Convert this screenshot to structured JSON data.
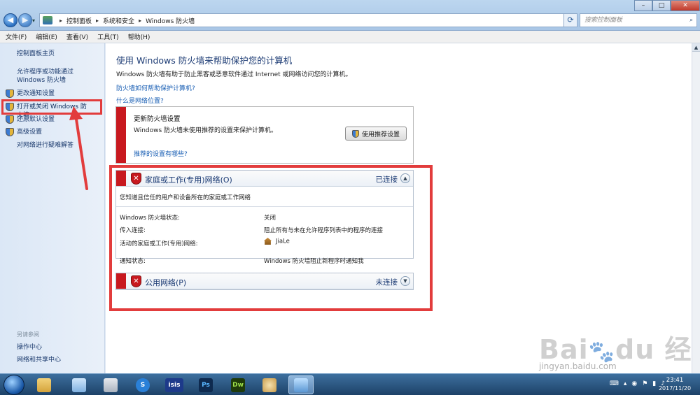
{
  "window": {
    "breadcrumbs": [
      "控制面板",
      "系统和安全",
      "Windows 防火墙"
    ],
    "search_placeholder": "搜索控制面板"
  },
  "menu": [
    "文件(F)",
    "编辑(E)",
    "查看(V)",
    "工具(T)",
    "帮助(H)"
  ],
  "sidebar": {
    "home": "控制面板主页",
    "items": [
      {
        "label": "允许程序或功能通过 Windows 防火墙",
        "icon": "none"
      },
      {
        "label": "更改通知设置",
        "icon": "shield-icon"
      },
      {
        "label": "打开或关闭 Windows 防火墙",
        "icon": "shield-icon"
      },
      {
        "label": "还原默认设置",
        "icon": "shield-icon"
      },
      {
        "label": "高级设置",
        "icon": "shield-icon"
      },
      {
        "label": "对网络进行疑难解答",
        "icon": "none"
      }
    ],
    "see_also_title": "另请参阅",
    "see_also": [
      "操作中心",
      "网络和共享中心"
    ]
  },
  "main": {
    "title": "使用 Windows 防火墙来帮助保护您的计算机",
    "description": "Windows 防火墙有助于防止黑客或恶意软件通过 Internet 或网络访问您的计算机。",
    "link1": "防火墙如何帮助保护计算机?",
    "link2": "什么是网络位置?",
    "update": {
      "heading": "更新防火墙设置",
      "text": "Windows 防火墙未使用推荐的设置来保护计算机。",
      "button": "使用推荐设置",
      "link": "推荐的设置有哪些?"
    },
    "home_network": {
      "name": "家庭或工作(专用)网络(O)",
      "status": "已连接",
      "intro": "您知道且信任的用户和设备所在的家庭或工作网络",
      "rows": [
        {
          "label": "Windows 防火墙状态:",
          "value": "关闭"
        },
        {
          "label": "传入连接:",
          "value": "阻止所有与未在允许程序列表中的程序的连接"
        },
        {
          "label": "活动的家庭或工作(专用)网络:",
          "value": "JiaLe"
        },
        {
          "label": "通知状态:",
          "value": "Windows 防火墙阻止新程序时通知我"
        }
      ]
    },
    "public_network": {
      "name": "公用网络(P)",
      "status": "未连接"
    }
  },
  "taskbar": {
    "apps": [
      "explorer",
      "notepad",
      "calculator",
      "sogou",
      "isis",
      "photoshop",
      "dreamweaver",
      "paint",
      "control-panel"
    ],
    "clock_time": "23:41",
    "clock_date": "2017/11/20"
  },
  "watermark": {
    "url": "jingyan.baidu.com"
  },
  "colors": {
    "accent_red": "#c8191f",
    "annotation_red": "#e23c3c",
    "link_blue": "#1a5fb4",
    "heading_blue": "#1c3b74"
  }
}
